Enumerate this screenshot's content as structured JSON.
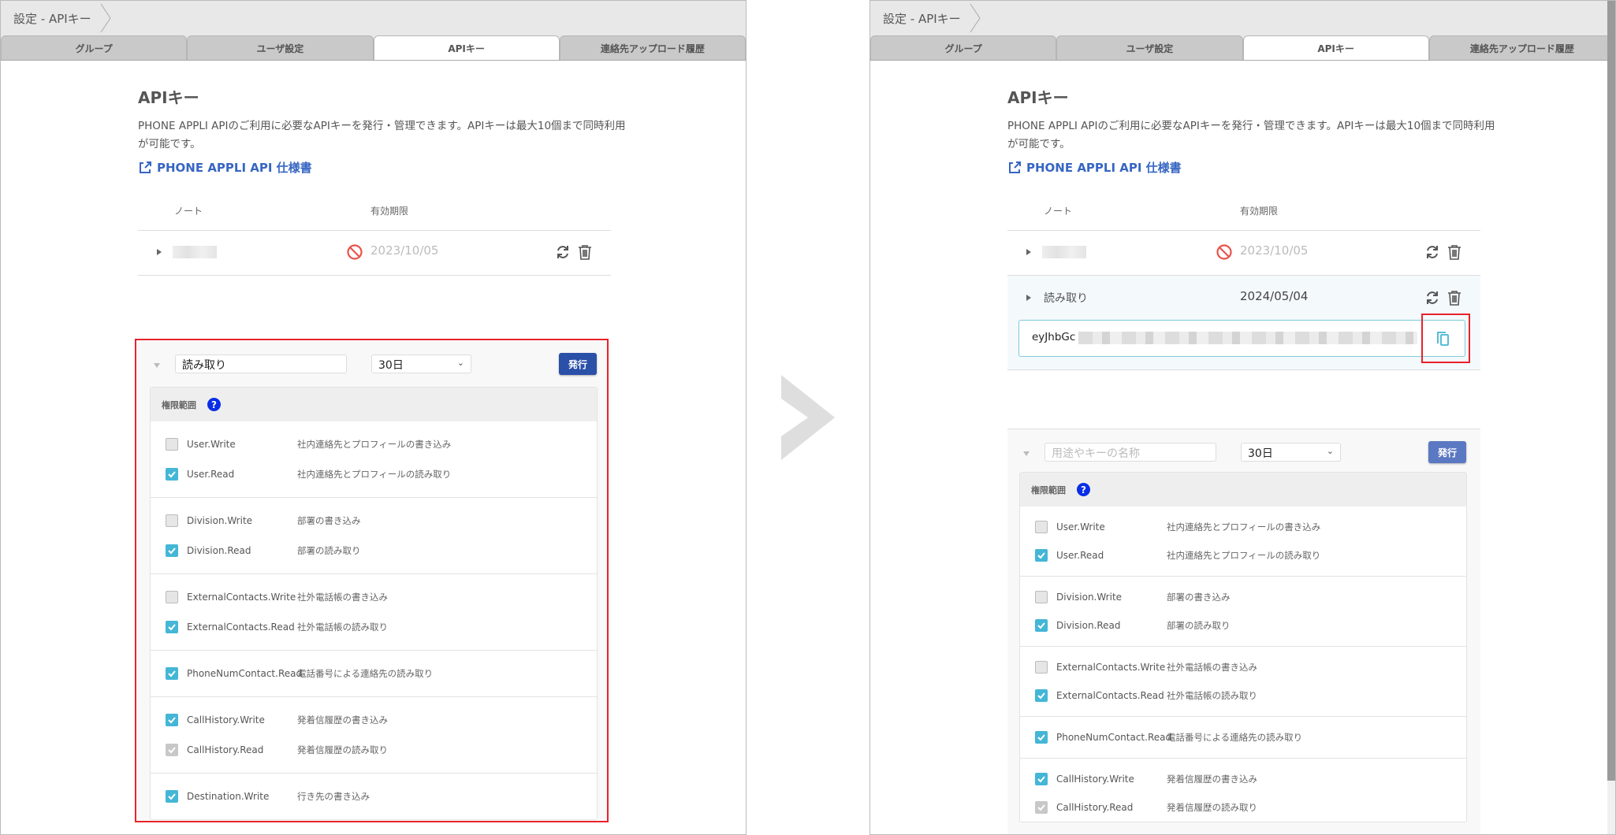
{
  "breadcrumb": "設定 - APIキー",
  "tabs": [
    {
      "label": "グループ"
    },
    {
      "label": "ユーザ設定"
    },
    {
      "label": "APIキー",
      "active": true
    },
    {
      "label": "連絡先アップロード履歴"
    }
  ],
  "page": {
    "title": "APIキー",
    "description": "PHONE APPLI APIのご利用に必要なAPIキーを発行・管理できます。APIキーは最大10個まで同時利用が可能です。",
    "spec_link": "PHONE APPLI API 仕様書",
    "columns": {
      "note": "ノート",
      "expiry": "有効期限"
    }
  },
  "left": {
    "keys": [
      {
        "note": "",
        "expiry": "2023/10/05",
        "expired": true
      }
    ],
    "form": {
      "name_value": "読み取り",
      "period": "30日",
      "issue_label": "発行"
    }
  },
  "right": {
    "keys": [
      {
        "note": "",
        "expiry": "2023/10/05",
        "expired": true
      },
      {
        "note": "読み取り",
        "expiry": "2024/05/04",
        "expired": false
      }
    ],
    "token_prefix": "eyJhbGc",
    "form": {
      "name_placeholder": "用途やキーの名称",
      "period": "30日",
      "issue_label": "発行"
    }
  },
  "permissions": {
    "header": "権限範囲",
    "groups": [
      [
        {
          "name": "User.Write",
          "desc": "社内連絡先とプロフィールの書き込み",
          "state": "off"
        },
        {
          "name": "User.Read",
          "desc": "社内連絡先とプロフィールの読み取り",
          "state": "on"
        }
      ],
      [
        {
          "name": "Division.Write",
          "desc": "部署の書き込み",
          "state": "off"
        },
        {
          "name": "Division.Read",
          "desc": "部署の読み取り",
          "state": "on"
        }
      ],
      [
        {
          "name": "ExternalContacts.Write",
          "desc": "社外電話帳の書き込み",
          "state": "off"
        },
        {
          "name": "ExternalContacts.Read",
          "desc": "社外電話帳の読み取り",
          "state": "on"
        }
      ],
      [
        {
          "name": "PhoneNumContact.Read",
          "desc": "電話番号による連絡先の読み取り",
          "state": "on"
        }
      ],
      [
        {
          "name": "CallHistory.Write",
          "desc": "発着信履歴の書き込み",
          "state": "on"
        },
        {
          "name": "CallHistory.Read",
          "desc": "発着信履歴の読み取り",
          "state": "disabled"
        }
      ],
      [
        {
          "name": "Destination.Write",
          "desc": "行き先の書き込み",
          "state": "on"
        }
      ]
    ]
  },
  "colors": {
    "accent": "#2a50a8",
    "link": "#3766c2",
    "checkbox": "#44b6d6",
    "highlight": "#e8222b"
  }
}
